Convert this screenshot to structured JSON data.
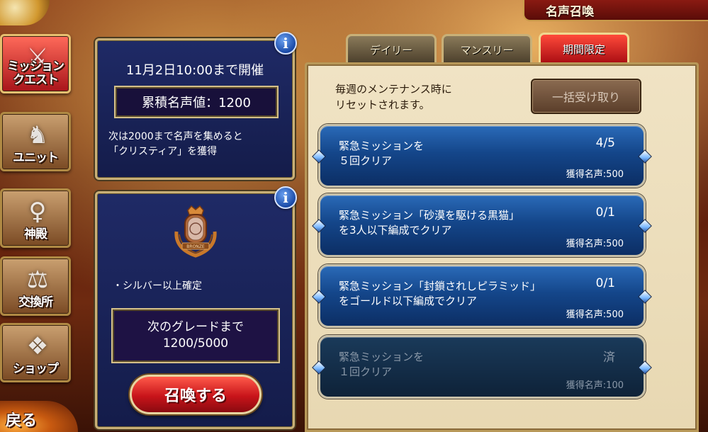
{
  "header": {
    "title": "名声召喚"
  },
  "nav": {
    "items": [
      {
        "label": "ミッション\nクエスト",
        "icon": "crossed-swords-icon",
        "active": true
      },
      {
        "label": "ユニット",
        "icon": "knight-helmet-icon",
        "active": false
      },
      {
        "label": "神殿",
        "icon": "goddess-icon",
        "active": false
      },
      {
        "label": "交換所",
        "icon": "scales-icon",
        "active": false
      },
      {
        "label": "ショップ",
        "icon": "crystal-icon",
        "active": false
      }
    ],
    "back_label": "戻る"
  },
  "event_panel": {
    "period": "11月2日10:00まで開催",
    "fame_total": "累積名声値：1200",
    "next_reward_line1": "次は2000まで名声を集めると",
    "next_reward_line2": "「クリスティア」を獲得",
    "info_glyph": "i"
  },
  "summon_panel": {
    "guarantee": "・シルバー以上確定",
    "next_grade_label": "次のグレードまで",
    "next_grade_progress": "1200/5000",
    "summon_button": "召喚する",
    "info_glyph": "i",
    "emblem_text": "BRONZE"
  },
  "tabs": [
    {
      "label": "デイリー",
      "active": false
    },
    {
      "label": "マンスリー",
      "active": false
    },
    {
      "label": "期間限定",
      "active": true
    }
  ],
  "mission_panel": {
    "notice_line1": "毎週のメンテナンス時に",
    "notice_line2": "リセットされます。",
    "claim_all_button": "一括受け取り",
    "missions": [
      {
        "title": "緊急ミッションを\n５回クリア",
        "progress": "4/5",
        "reward": "獲得名声:500",
        "completed": false
      },
      {
        "title": "緊急ミッション「砂漠を駆ける黒猫」\nを3人以下編成でクリア",
        "progress": "0/1",
        "reward": "獲得名声:500",
        "completed": false
      },
      {
        "title": "緊急ミッション「封鎖されしピラミッド」\nをゴールド以下編成でクリア",
        "progress": "0/1",
        "reward": "獲得名声:500",
        "completed": false
      },
      {
        "title": "緊急ミッションを\n１回クリア",
        "progress": "済",
        "reward": "獲得名声:100",
        "completed": true
      }
    ]
  }
}
